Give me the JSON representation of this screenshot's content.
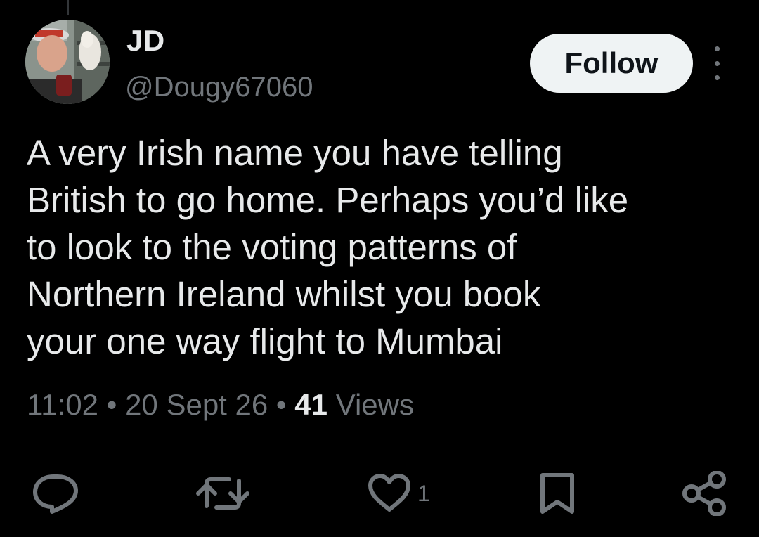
{
  "author": {
    "display_name": "JD",
    "handle": "@Dougy67060"
  },
  "header": {
    "follow_label": "Follow"
  },
  "tweet": {
    "lines": [
      "A very Irish name you have telling",
      "British to go home. Perhaps you’d like",
      "to look to the voting patterns of",
      "Northern Ireland whilst you book",
      "your one way flight to Mumbai"
    ]
  },
  "meta": {
    "time": "11:02",
    "separator": "•",
    "date": "20 Sept 26",
    "views_count": "41",
    "views_label": "Views"
  },
  "actions": {
    "like_count": "1"
  },
  "icons": {
    "reply": "reply-icon",
    "retweet": "retweet-icon",
    "like": "heart-icon",
    "bookmark": "bookmark-icon",
    "share": "share-icon",
    "more": "more-vertical-icon"
  },
  "colors": {
    "background": "#000000",
    "primary_text": "#e7e9ea",
    "secondary_text": "#71767b",
    "follow_button_bg": "#eff3f4",
    "follow_button_text": "#0f1419"
  }
}
